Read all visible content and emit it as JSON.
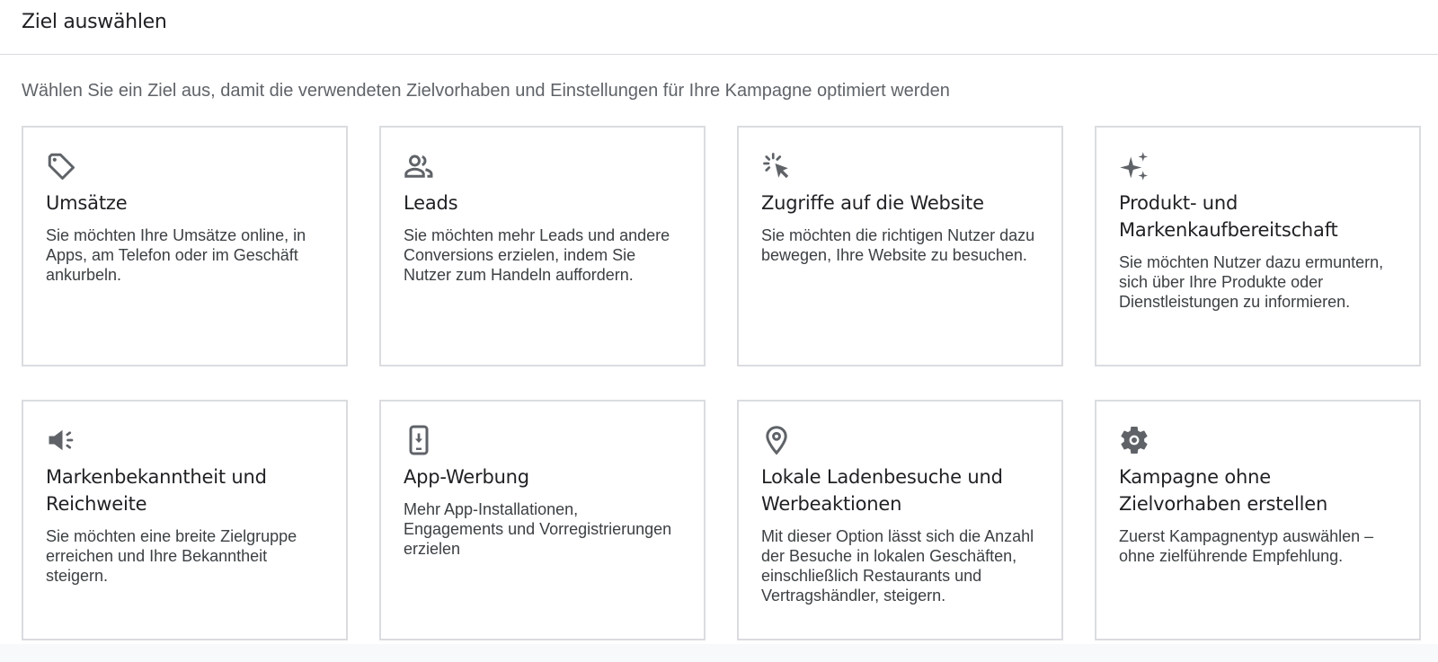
{
  "header": {
    "title": "Ziel auswählen"
  },
  "subtitle": "Wählen Sie ein Ziel aus, damit die verwendeten Zielvorhaben und Einstellungen für Ihre Kampagne optimiert werden",
  "cards": [
    {
      "icon": "tag-icon",
      "title": "Umsätze",
      "description": "Sie möchten Ihre Umsätze online, in Apps, am Telefon oder im Geschäft ankurbeln."
    },
    {
      "icon": "people-icon",
      "title": "Leads",
      "description": "Sie möchten mehr Leads und andere Conversions erzielen, indem Sie Nutzer zum Handeln auffordern."
    },
    {
      "icon": "cursor-click-icon",
      "title": "Zugriffe auf die Website",
      "description": "Sie möchten die richtigen Nutzer dazu bewegen, Ihre Website zu besuchen."
    },
    {
      "icon": "sparkle-icon",
      "title": "Produkt- und Markenkaufbereitschaft",
      "description": "Sie möchten Nutzer dazu ermuntern, sich über Ihre Produkte oder Dienstleistungen zu informieren."
    },
    {
      "icon": "megaphone-icon",
      "title": "Markenbekanntheit und Reichweite",
      "description": "Sie möchten eine breite Zielgruppe erreichen und Ihre Bekanntheit steigern."
    },
    {
      "icon": "phone-download-icon",
      "title": "App-Werbung",
      "description": "Mehr App-Installationen, Engagements und Vorregistrierungen erzielen"
    },
    {
      "icon": "location-pin-icon",
      "title": "Lokale Ladenbesuche und Werbeaktionen",
      "description": "Mit dieser Option lässt sich die Anzahl der Besuche in lokalen Geschäften, einschließlich Restaurants und Vertragshändler, steigern."
    },
    {
      "icon": "gear-icon",
      "title": "Kampagne ohne Zielvorhaben erstellen",
      "description": "Zuerst Kampagnentyp auswählen – ohne zielführende Empfehlung."
    }
  ],
  "colors": {
    "icon": "#5f6368",
    "title": "#202124",
    "text": "#3c4043",
    "border": "#dadce0"
  }
}
